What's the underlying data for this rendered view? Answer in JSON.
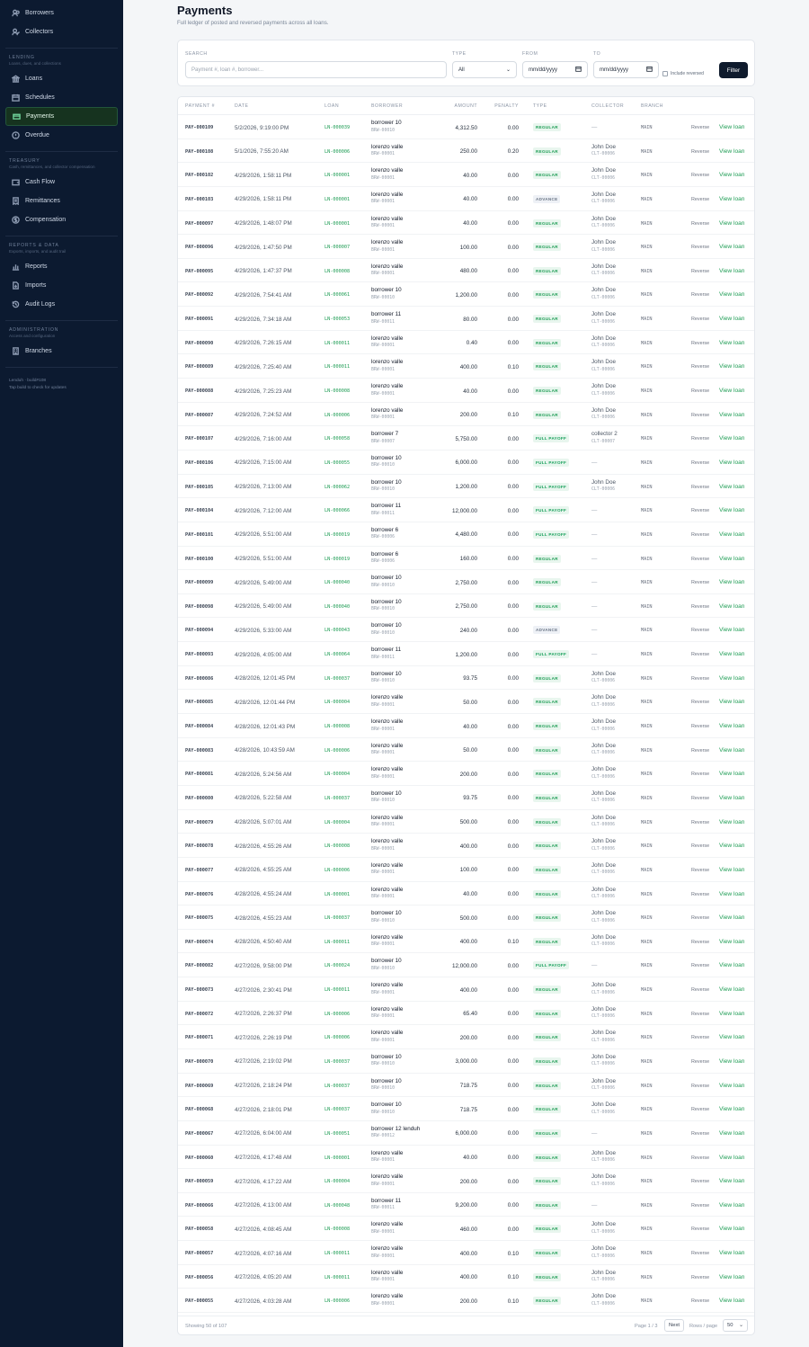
{
  "sidebar": {
    "top_items": [
      {
        "label": "Borrowers",
        "icon": "users-icon"
      },
      {
        "label": "Collectors",
        "icon": "user-check-icon"
      }
    ],
    "sections": [
      {
        "heading": "LENDING",
        "sub": "Loans, dues, and collections",
        "items": [
          {
            "label": "Loans",
            "icon": "bank-icon"
          },
          {
            "label": "Schedules",
            "icon": "calendar-icon"
          },
          {
            "label": "Payments",
            "icon": "card-icon",
            "active": true
          },
          {
            "label": "Overdue",
            "icon": "alert-icon"
          }
        ]
      },
      {
        "heading": "TREASURY",
        "sub": "Cash, remittances, and collector compensation",
        "items": [
          {
            "label": "Cash Flow",
            "icon": "wallet-icon"
          },
          {
            "label": "Remittances",
            "icon": "receipt-icon"
          },
          {
            "label": "Compensation",
            "icon": "dollar-icon"
          }
        ]
      },
      {
        "heading": "REPORTS & DATA",
        "sub": "Exports, imports, and audit trail",
        "items": [
          {
            "label": "Reports",
            "icon": "bar-chart-icon"
          },
          {
            "label": "Imports",
            "icon": "file-import-icon"
          },
          {
            "label": "Audit Logs",
            "icon": "history-icon"
          }
        ]
      },
      {
        "heading": "ADMINISTRATION",
        "sub": "Access and configuration",
        "items": [
          {
            "label": "Branches",
            "icon": "building-icon"
          }
        ]
      }
    ],
    "footer_line1": "Lenduh · build#108",
    "footer_line2": "Tap build to check for updates"
  },
  "header": {
    "title": "Payments",
    "subtitle": "Full ledger of posted and reversed payments across all loans."
  },
  "filters": {
    "search_label": "SEARCH",
    "search_placeholder": "Payment #, loan #, borrower...",
    "type_label": "TYPE",
    "type_value": "All",
    "from_label": "FROM",
    "from_value": "mm/dd/yyyy",
    "to_label": "TO",
    "to_value": "mm/dd/yyyy",
    "include_reversed": "Include reversed",
    "filter_button": "Filter"
  },
  "table": {
    "columns": [
      "PAYMENT #",
      "DATE",
      "LOAN",
      "BORROWER",
      "AMOUNT",
      "PENALTY",
      "TYPE",
      "COLLECTOR",
      "BRANCH"
    ],
    "reverse_label": "Reverse",
    "view_label": "View loan",
    "rows": [
      [
        "PAY-000109",
        "5/2/2026, 9:19:00 PM",
        "LN-000039",
        "borrower 10",
        "BRW-00010",
        "4,312.50",
        "0.00",
        "REGULAR",
        "—",
        "",
        "MAIN"
      ],
      [
        "PAY-000108",
        "5/1/2026, 7:55:20 AM",
        "LN-000006",
        "lorenzo valle",
        "BRW-00001",
        "250.00",
        "0.20",
        "REGULAR",
        "John Doe",
        "CLT-00006",
        "MAIN"
      ],
      [
        "PAY-000102",
        "4/29/2026, 1:58:11 PM",
        "LN-000001",
        "lorenzo valle",
        "BRW-00001",
        "40.00",
        "0.00",
        "REGULAR",
        "John Doe",
        "CLT-00006",
        "MAIN"
      ],
      [
        "PAY-000103",
        "4/29/2026, 1:58:11 PM",
        "LN-000001",
        "lorenzo valle",
        "BRW-00001",
        "40.00",
        "0.00",
        "ADVANCE",
        "John Doe",
        "CLT-00006",
        "MAIN"
      ],
      [
        "PAY-000097",
        "4/29/2026, 1:48:07 PM",
        "LN-000001",
        "lorenzo valle",
        "BRW-00001",
        "40.00",
        "0.00",
        "REGULAR",
        "John Doe",
        "CLT-00006",
        "MAIN"
      ],
      [
        "PAY-000096",
        "4/29/2026, 1:47:50 PM",
        "LN-000007",
        "lorenzo valle",
        "BRW-00001",
        "100.00",
        "0.00",
        "REGULAR",
        "John Doe",
        "CLT-00006",
        "MAIN"
      ],
      [
        "PAY-000095",
        "4/29/2026, 1:47:37 PM",
        "LN-000008",
        "lorenzo valle",
        "BRW-00001",
        "480.00",
        "0.00",
        "REGULAR",
        "John Doe",
        "CLT-00006",
        "MAIN"
      ],
      [
        "PAY-000092",
        "4/29/2026, 7:54:41 AM",
        "LN-000061",
        "borrower 10",
        "BRW-00010",
        "1,200.00",
        "0.00",
        "REGULAR",
        "John Doe",
        "CLT-00006",
        "MAIN"
      ],
      [
        "PAY-000091",
        "4/29/2026, 7:34:18 AM",
        "LN-000053",
        "borrower 11",
        "BRW-00011",
        "80.00",
        "0.00",
        "REGULAR",
        "John Doe",
        "CLT-00006",
        "MAIN"
      ],
      [
        "PAY-000090",
        "4/29/2026, 7:26:15 AM",
        "LN-000011",
        "lorenzo valle",
        "BRW-00001",
        "0.40",
        "0.00",
        "REGULAR",
        "John Doe",
        "CLT-00006",
        "MAIN"
      ],
      [
        "PAY-000089",
        "4/29/2026, 7:25:40 AM",
        "LN-000011",
        "lorenzo valle",
        "BRW-00001",
        "400.00",
        "0.10",
        "REGULAR",
        "John Doe",
        "CLT-00006",
        "MAIN"
      ],
      [
        "PAY-000088",
        "4/29/2026, 7:25:23 AM",
        "LN-000008",
        "lorenzo valle",
        "BRW-00001",
        "40.00",
        "0.00",
        "REGULAR",
        "John Doe",
        "CLT-00006",
        "MAIN"
      ],
      [
        "PAY-000087",
        "4/29/2026, 7:24:52 AM",
        "LN-000006",
        "lorenzo valle",
        "BRW-00001",
        "200.00",
        "0.10",
        "REGULAR",
        "John Doe",
        "CLT-00006",
        "MAIN"
      ],
      [
        "PAY-000107",
        "4/29/2026, 7:16:00 AM",
        "LN-000058",
        "borrower 7",
        "BRW-00007",
        "5,750.00",
        "0.00",
        "FULL PAYOFF",
        "collector 2",
        "CLT-00007",
        "MAIN"
      ],
      [
        "PAY-000106",
        "4/29/2026, 7:15:00 AM",
        "LN-000055",
        "borrower 10",
        "BRW-00010",
        "6,000.00",
        "0.00",
        "FULL PAYOFF",
        "—",
        "",
        "MAIN"
      ],
      [
        "PAY-000105",
        "4/29/2026, 7:13:00 AM",
        "LN-000062",
        "borrower 10",
        "BRW-00010",
        "1,200.00",
        "0.00",
        "FULL PAYOFF",
        "John Doe",
        "CLT-00006",
        "MAIN"
      ],
      [
        "PAY-000104",
        "4/29/2026, 7:12:00 AM",
        "LN-000066",
        "borrower 11",
        "BRW-00011",
        "12,000.00",
        "0.00",
        "FULL PAYOFF",
        "—",
        "",
        "MAIN"
      ],
      [
        "PAY-000101",
        "4/29/2026, 5:51:00 AM",
        "LN-000019",
        "borrower 6",
        "BRW-00006",
        "4,480.00",
        "0.00",
        "FULL PAYOFF",
        "—",
        "",
        "MAIN"
      ],
      [
        "PAY-000100",
        "4/29/2026, 5:51:00 AM",
        "LN-000019",
        "borrower 6",
        "BRW-00006",
        "160.00",
        "0.00",
        "REGULAR",
        "—",
        "",
        "MAIN"
      ],
      [
        "PAY-000099",
        "4/29/2026, 5:49:00 AM",
        "LN-000040",
        "borrower 10",
        "BRW-00010",
        "2,750.00",
        "0.00",
        "REGULAR",
        "—",
        "",
        "MAIN"
      ],
      [
        "PAY-000098",
        "4/29/2026, 5:49:00 AM",
        "LN-000040",
        "borrower 10",
        "BRW-00010",
        "2,750.00",
        "0.00",
        "REGULAR",
        "—",
        "",
        "MAIN"
      ],
      [
        "PAY-000094",
        "4/29/2026, 5:33:00 AM",
        "LN-000043",
        "borrower 10",
        "BRW-00010",
        "240.00",
        "0.00",
        "ADVANCE",
        "—",
        "",
        "MAIN"
      ],
      [
        "PAY-000093",
        "4/29/2026, 4:05:00 AM",
        "LN-000064",
        "borrower 11",
        "BRW-00011",
        "1,200.00",
        "0.00",
        "FULL PAYOFF",
        "—",
        "",
        "MAIN"
      ],
      [
        "PAY-000086",
        "4/28/2026, 12:01:45 PM",
        "LN-000037",
        "borrower 10",
        "BRW-00010",
        "93.75",
        "0.00",
        "REGULAR",
        "John Doe",
        "CLT-00006",
        "MAIN"
      ],
      [
        "PAY-000085",
        "4/28/2026, 12:01:44 PM",
        "LN-000004",
        "lorenzo valle",
        "BRW-00001",
        "50.00",
        "0.00",
        "REGULAR",
        "John Doe",
        "CLT-00006",
        "MAIN"
      ],
      [
        "PAY-000084",
        "4/28/2026, 12:01:43 PM",
        "LN-000008",
        "lorenzo valle",
        "BRW-00001",
        "40.00",
        "0.00",
        "REGULAR",
        "John Doe",
        "CLT-00006",
        "MAIN"
      ],
      [
        "PAY-000083",
        "4/28/2026, 10:43:59 AM",
        "LN-000006",
        "lorenzo valle",
        "BRW-00001",
        "50.00",
        "0.00",
        "REGULAR",
        "John Doe",
        "CLT-00006",
        "MAIN"
      ],
      [
        "PAY-000081",
        "4/28/2026, 5:24:56 AM",
        "LN-000004",
        "lorenzo valle",
        "BRW-00001",
        "200.00",
        "0.00",
        "REGULAR",
        "John Doe",
        "CLT-00006",
        "MAIN"
      ],
      [
        "PAY-000080",
        "4/28/2026, 5:22:58 AM",
        "LN-000037",
        "borrower 10",
        "BRW-00010",
        "93.75",
        "0.00",
        "REGULAR",
        "John Doe",
        "CLT-00006",
        "MAIN"
      ],
      [
        "PAY-000079",
        "4/28/2026, 5:07:01 AM",
        "LN-000004",
        "lorenzo valle",
        "BRW-00001",
        "500.00",
        "0.00",
        "REGULAR",
        "John Doe",
        "CLT-00006",
        "MAIN"
      ],
      [
        "PAY-000078",
        "4/28/2026, 4:55:26 AM",
        "LN-000008",
        "lorenzo valle",
        "BRW-00001",
        "400.00",
        "0.00",
        "REGULAR",
        "John Doe",
        "CLT-00006",
        "MAIN"
      ],
      [
        "PAY-000077",
        "4/28/2026, 4:55:25 AM",
        "LN-000006",
        "lorenzo valle",
        "BRW-00001",
        "100.00",
        "0.00",
        "REGULAR",
        "John Doe",
        "CLT-00006",
        "MAIN"
      ],
      [
        "PAY-000076",
        "4/28/2026, 4:55:24 AM",
        "LN-000001",
        "lorenzo valle",
        "BRW-00001",
        "40.00",
        "0.00",
        "REGULAR",
        "John Doe",
        "CLT-00006",
        "MAIN"
      ],
      [
        "PAY-000075",
        "4/28/2026, 4:55:23 AM",
        "LN-000037",
        "borrower 10",
        "BRW-00010",
        "500.00",
        "0.00",
        "REGULAR",
        "John Doe",
        "CLT-00006",
        "MAIN"
      ],
      [
        "PAY-000074",
        "4/28/2026, 4:50:40 AM",
        "LN-000011",
        "lorenzo valle",
        "BRW-00001",
        "400.00",
        "0.10",
        "REGULAR",
        "John Doe",
        "CLT-00006",
        "MAIN"
      ],
      [
        "PAY-000082",
        "4/27/2026, 9:58:00 PM",
        "LN-000024",
        "borrower 10",
        "BRW-00010",
        "12,000.00",
        "0.00",
        "FULL PAYOFF",
        "—",
        "",
        "MAIN"
      ],
      [
        "PAY-000073",
        "4/27/2026, 2:30:41 PM",
        "LN-000011",
        "lorenzo valle",
        "BRW-00001",
        "400.00",
        "0.00",
        "REGULAR",
        "John Doe",
        "CLT-00006",
        "MAIN"
      ],
      [
        "PAY-000072",
        "4/27/2026, 2:26:37 PM",
        "LN-000006",
        "lorenzo valle",
        "BRW-00001",
        "65.40",
        "0.00",
        "REGULAR",
        "John Doe",
        "CLT-00006",
        "MAIN"
      ],
      [
        "PAY-000071",
        "4/27/2026, 2:26:19 PM",
        "LN-000006",
        "lorenzo valle",
        "BRW-00001",
        "200.00",
        "0.00",
        "REGULAR",
        "John Doe",
        "CLT-00006",
        "MAIN"
      ],
      [
        "PAY-000070",
        "4/27/2026, 2:19:02 PM",
        "LN-000037",
        "borrower 10",
        "BRW-00010",
        "3,000.00",
        "0.00",
        "REGULAR",
        "John Doe",
        "CLT-00006",
        "MAIN"
      ],
      [
        "PAY-000069",
        "4/27/2026, 2:18:24 PM",
        "LN-000037",
        "borrower 10",
        "BRW-00010",
        "718.75",
        "0.00",
        "REGULAR",
        "John Doe",
        "CLT-00006",
        "MAIN"
      ],
      [
        "PAY-000068",
        "4/27/2026, 2:18:01 PM",
        "LN-000037",
        "borrower 10",
        "BRW-00010",
        "718.75",
        "0.00",
        "REGULAR",
        "John Doe",
        "CLT-00006",
        "MAIN"
      ],
      [
        "PAY-000067",
        "4/27/2026, 6:04:00 AM",
        "LN-000051",
        "borrower 12 lenduh",
        "BRW-00012",
        "6,000.00",
        "0.00",
        "REGULAR",
        "—",
        "",
        "MAIN"
      ],
      [
        "PAY-000060",
        "4/27/2026, 4:17:48 AM",
        "LN-000001",
        "lorenzo valle",
        "BRW-00001",
        "40.00",
        "0.00",
        "REGULAR",
        "John Doe",
        "CLT-00006",
        "MAIN"
      ],
      [
        "PAY-000059",
        "4/27/2026, 4:17:22 AM",
        "LN-000004",
        "lorenzo valle",
        "BRW-00001",
        "200.00",
        "0.00",
        "REGULAR",
        "John Doe",
        "CLT-00006",
        "MAIN"
      ],
      [
        "PAY-000066",
        "4/27/2026, 4:13:00 AM",
        "LN-000048",
        "borrower 11",
        "BRW-00011",
        "9,200.00",
        "0.00",
        "REGULAR",
        "—",
        "",
        "MAIN"
      ],
      [
        "PAY-000058",
        "4/27/2026, 4:08:45 AM",
        "LN-000008",
        "lorenzo valle",
        "BRW-00001",
        "460.00",
        "0.00",
        "REGULAR",
        "John Doe",
        "CLT-00006",
        "MAIN"
      ],
      [
        "PAY-000057",
        "4/27/2026, 4:07:16 AM",
        "LN-000011",
        "lorenzo valle",
        "BRW-00001",
        "400.00",
        "0.10",
        "REGULAR",
        "John Doe",
        "CLT-00006",
        "MAIN"
      ],
      [
        "PAY-000056",
        "4/27/2026, 4:05:20 AM",
        "LN-000011",
        "lorenzo valle",
        "BRW-00001",
        "400.00",
        "0.10",
        "REGULAR",
        "John Doe",
        "CLT-00006",
        "MAIN"
      ],
      [
        "PAY-000055",
        "4/27/2026, 4:03:28 AM",
        "LN-000006",
        "lorenzo valle",
        "BRW-00001",
        "200.00",
        "0.10",
        "REGULAR",
        "John Doe",
        "CLT-00006",
        "MAIN"
      ]
    ]
  },
  "pagination": {
    "showing": "Showing 50 of 107",
    "page_info": "Page 1 / 3",
    "next": "Next",
    "rows_label": "Rows / page",
    "rows_value": "50"
  },
  "colors": {
    "sidebar_bg": "#0c1a30",
    "accent": "#1f9d55",
    "button_dark": "#0f1b2d"
  }
}
